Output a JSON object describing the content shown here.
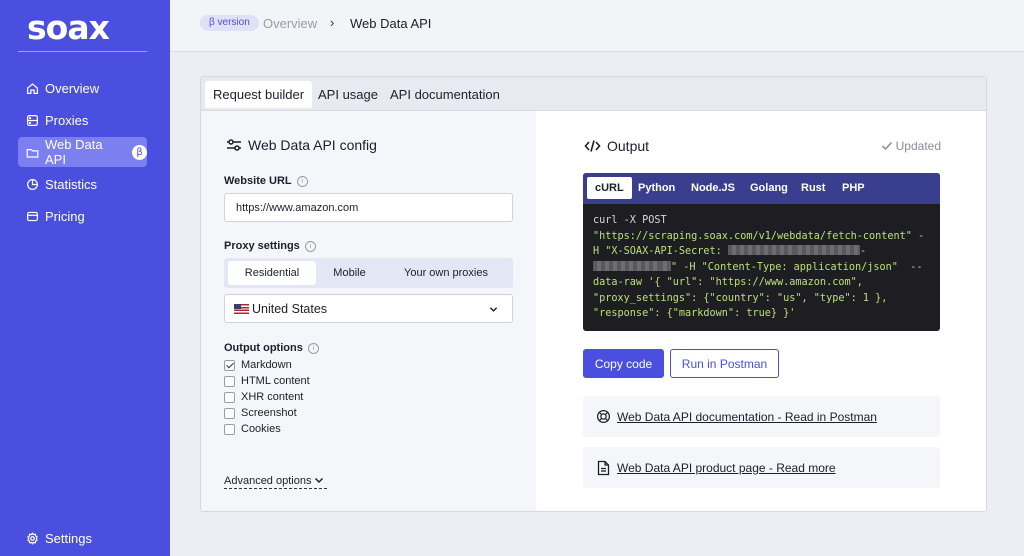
{
  "sidebar": {
    "logo": "soax",
    "items": [
      {
        "label": "Overview",
        "icon": "home-icon"
      },
      {
        "label": "Proxies",
        "icon": "server-icon"
      },
      {
        "label": "Web Data API",
        "icon": "folder-icon",
        "badge": "β",
        "active": true
      },
      {
        "label": "Statistics",
        "icon": "pie-chart-icon"
      },
      {
        "label": "Pricing",
        "icon": "wallet-icon"
      }
    ],
    "settings_label": "Settings"
  },
  "header": {
    "beta_badge": "β version",
    "breadcrumb_parent": "Overview",
    "breadcrumb_separator": "›",
    "breadcrumb_current": "Web Data API"
  },
  "tabs": [
    {
      "label": "Request builder",
      "active": true
    },
    {
      "label": "API usage"
    },
    {
      "label": "API documentation"
    }
  ],
  "config": {
    "title": "Web Data API config",
    "website_url_label": "Website URL",
    "website_url_value": "https://www.amazon.com",
    "proxy_settings_label": "Proxy settings",
    "proxy_types": [
      "Residential",
      "Mobile",
      "Your own proxies"
    ],
    "proxy_type_selected": "Residential",
    "country": "United States",
    "output_options_label": "Output options",
    "output_options": [
      {
        "label": "Markdown",
        "checked": true
      },
      {
        "label": "HTML content",
        "checked": false
      },
      {
        "label": "XHR content",
        "checked": false
      },
      {
        "label": "Screenshot",
        "checked": false
      },
      {
        "label": "Cookies",
        "checked": false
      }
    ],
    "advanced_options_label": "Advanced options"
  },
  "output": {
    "title": "Output",
    "status": "Updated",
    "code_tabs": [
      "cURL",
      "Python",
      "Node.JS",
      "Golang",
      "Rust",
      "PHP"
    ],
    "code_tab_selected": "cURL",
    "code": {
      "line1": "curl -X POST",
      "line2": "\"https://scraping.soax.com/v1/webdata/fetch-content\" -",
      "line3_start": "H \"X-SOAX-API-Secret: ",
      "line3_end": "-",
      "line4_end": "\" -H \"Content-Type: application/json\"  --",
      "line5": "data-raw '{ \"url\": \"https://www.amazon.com\",",
      "line6": "\"proxy_settings\": {\"country\": \"us\", \"type\": 1 },",
      "line7": "\"response\": {\"markdown\": true} }'"
    },
    "copy_button": "Copy code",
    "postman_button": "Run in Postman",
    "links": [
      {
        "label": "Web Data API documentation - Read in Postman",
        "icon": "lifebuoy-icon"
      },
      {
        "label": "Web Data API product page - Read more",
        "icon": "document-icon"
      }
    ]
  },
  "colors": {
    "brand": "#4b4fe0",
    "code_bg": "#1e1e22",
    "code_text": "#b9e07a"
  }
}
